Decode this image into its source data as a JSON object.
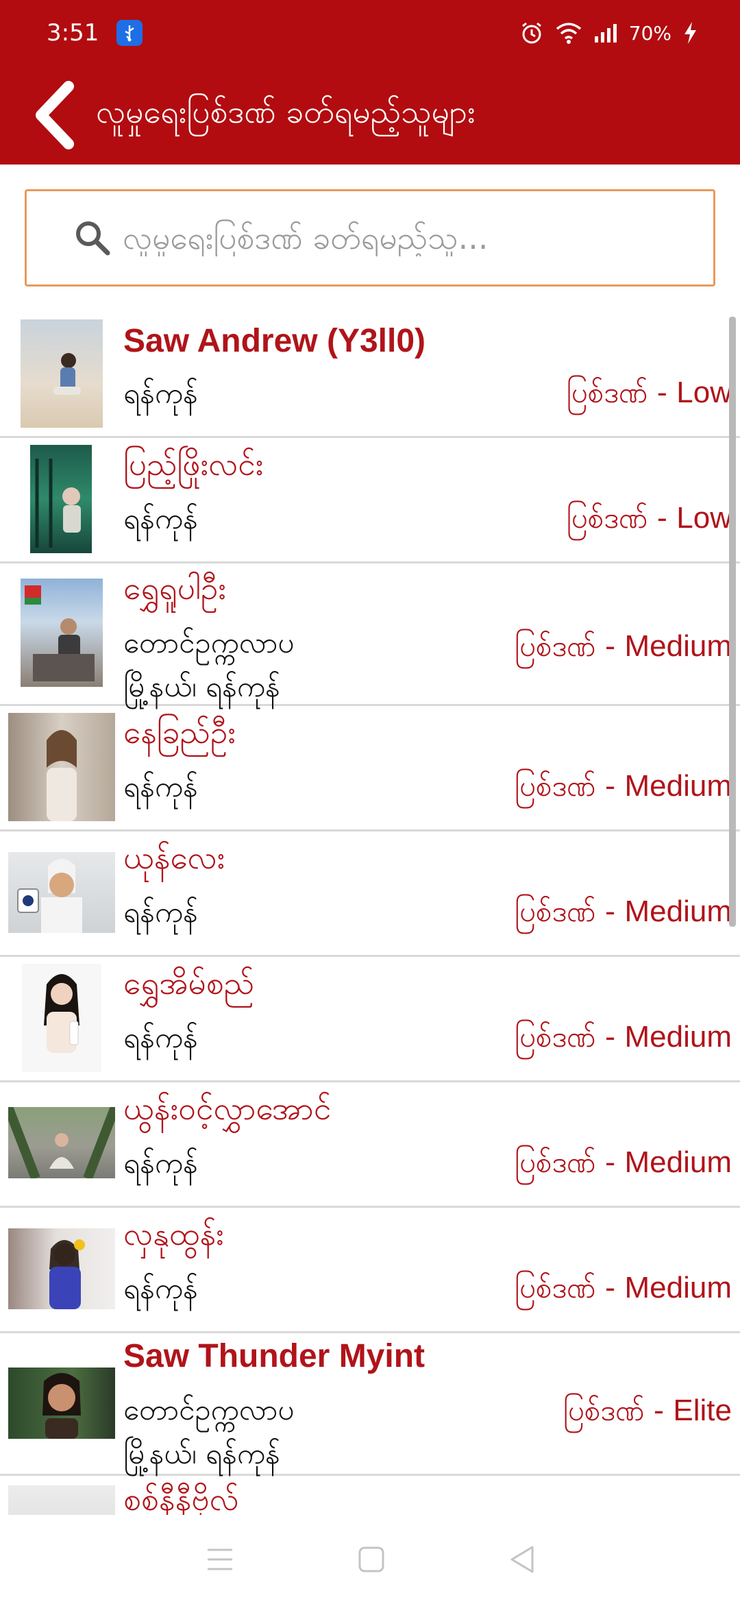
{
  "status": {
    "time": "3:51",
    "battery": "70%"
  },
  "header": {
    "title": "လူမှုရေးပြစ်ဒဏ် ခတ်ရမည့်သူများ"
  },
  "search": {
    "placeholder": "လူမှုရေးပြစ်ဒဏ် ခတ်ရမည့်သူ..."
  },
  "colors": {
    "brand": "#b20c10",
    "accent_text": "#b0141a",
    "search_border": "#e89a5a"
  },
  "people": [
    {
      "name": "Saw Andrew (Y3ll0)",
      "location": "ရန်ကုန်",
      "risk_label": "ပြစ်ဒဏ် - ",
      "risk_level": "Low"
    },
    {
      "name": "ပြည့်ဖြိုးလင်း",
      "location": "ရန်ကုန်",
      "risk_label": "ပြစ်ဒဏ် - ",
      "risk_level": "Low"
    },
    {
      "name": "ရွှေရူပါဦး",
      "location": "တောင်ဥက္ကလာပ",
      "location2": "မြို့နယ်၊ ရန်ကုန်",
      "risk_label": "ပြစ်ဒဏ် - ",
      "risk_level": "Medium"
    },
    {
      "name": "နေခြည်ဦး",
      "location": "ရန်ကုန်",
      "risk_label": "ပြစ်ဒဏ် - ",
      "risk_level": "Medium"
    },
    {
      "name": "ယုန်လေး",
      "location": "ရန်ကုန်",
      "risk_label": "ပြစ်ဒဏ် - ",
      "risk_level": "Medium"
    },
    {
      "name": "ရွှေအိမ်စည်",
      "location": "ရန်ကုန်",
      "risk_label": "ပြစ်ဒဏ် - ",
      "risk_level": "Medium"
    },
    {
      "name": "ယွန်းဝင့်လွှာအောင်",
      "location": "ရန်ကုန်",
      "risk_label": "ပြစ်ဒဏ် - ",
      "risk_level": "Medium"
    },
    {
      "name": "လှနုထွန်း",
      "location": "ရန်ကုန်",
      "risk_label": "ပြစ်ဒဏ် - ",
      "risk_level": "Medium"
    },
    {
      "name": "Saw Thunder Myint",
      "location": "တောင်ဥက္ကလာပ",
      "location2": "မြို့နယ်၊ ရန်ကုန်",
      "risk_label": "ပြစ်ဒဏ် - ",
      "risk_level": "Elite"
    },
    {
      "name": "စစ်နီနီဗိုလ်"
    }
  ]
}
